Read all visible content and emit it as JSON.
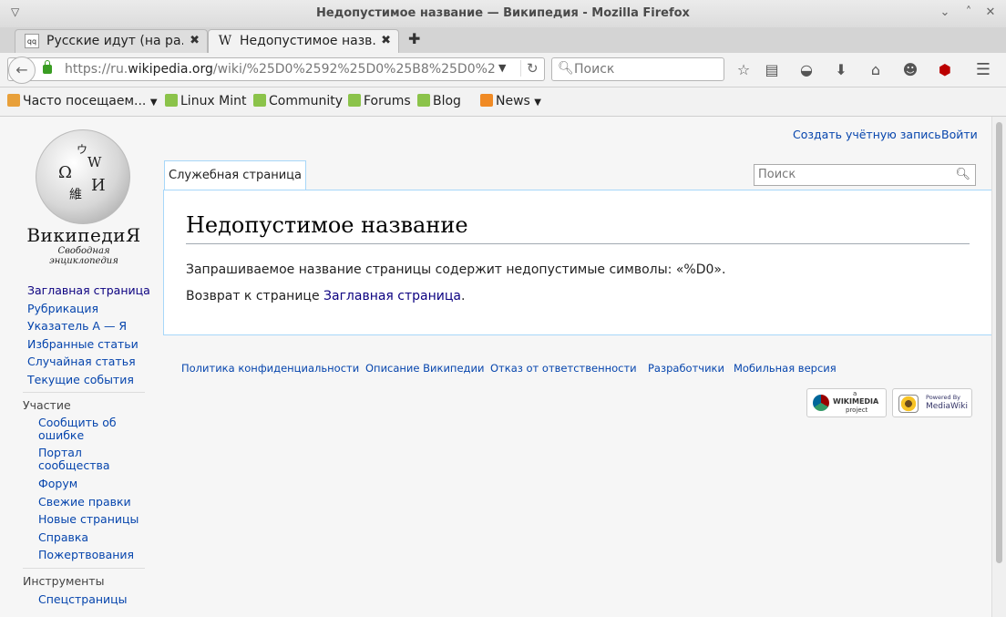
{
  "window": {
    "title": "Недопустимое название — Википедия - Mozilla Firefox",
    "controls": [
      "minimize",
      "maximize",
      "close"
    ]
  },
  "tabs": [
    {
      "label": "Русские идут (на ра...",
      "favicon": "qqcom-favicon",
      "active": false
    },
    {
      "label": "Недопустимое назв...",
      "favicon": "wikipedia-w-favicon",
      "active": true
    }
  ],
  "navbar": {
    "url_prefix": "https://ru.",
    "url_host": "wikipedia.org",
    "url_rest": "/wiki/%25D0%2592%25D0%25B8%25D0%25BA%",
    "search_placeholder": "Поиск"
  },
  "bookmarks": [
    {
      "label": "Часто посещаем...",
      "icon": "folder-icon",
      "dropdown": true
    },
    {
      "label": "Linux Mint",
      "icon": "mint-icon"
    },
    {
      "label": "Community",
      "icon": "mint-icon"
    },
    {
      "label": "Forums",
      "icon": "mint-icon"
    },
    {
      "label": "Blog",
      "icon": "mint-icon"
    },
    {
      "label": "News",
      "icon": "rss-icon",
      "dropdown": true
    }
  ],
  "wiki": {
    "wordmark": "ВикипедиЯ",
    "tagline": "Свободная энциклопедия",
    "personal": {
      "create_account": "Создать учётную запись",
      "login": "Войти"
    },
    "tab_special": "Служебная страница",
    "search_placeholder": "Поиск",
    "heading": "Недопустимое название",
    "message": "Запрашиваемое название страницы содержит недопустимые символы: «%D0».",
    "return_prefix": "Возврат к странице ",
    "return_link": "Заглавная страница",
    "return_suffix": ".",
    "nav_main": [
      "Заглавная страница",
      "Рубрикация",
      "Указатель А — Я",
      "Избранные статьи",
      "Случайная статья",
      "Текущие события"
    ],
    "section_participation": "Участие",
    "nav_participation": [
      "Сообщить об ошибке",
      "Портал сообщества",
      "Форум",
      "Свежие правки",
      "Новые страницы",
      "Справка",
      "Пожертвования"
    ],
    "section_tools": "Инструменты",
    "nav_tools": [
      "Спецстраницы"
    ],
    "footer_links": [
      "Политика конфиденциальности",
      "Описание Википедии",
      "Отказ от ответственности",
      "Разработчики",
      "Мобильная версия"
    ],
    "badge_wikimedia": {
      "a": "a",
      "name": "WIKIMEDIA",
      "sub": "project"
    },
    "badge_mediawiki": {
      "top": "Powered By",
      "name": "MediaWiki"
    }
  },
  "colors": {
    "link": "#0645ad",
    "visited_link": "#0b0080",
    "border_blue": "#a7d7f9"
  }
}
